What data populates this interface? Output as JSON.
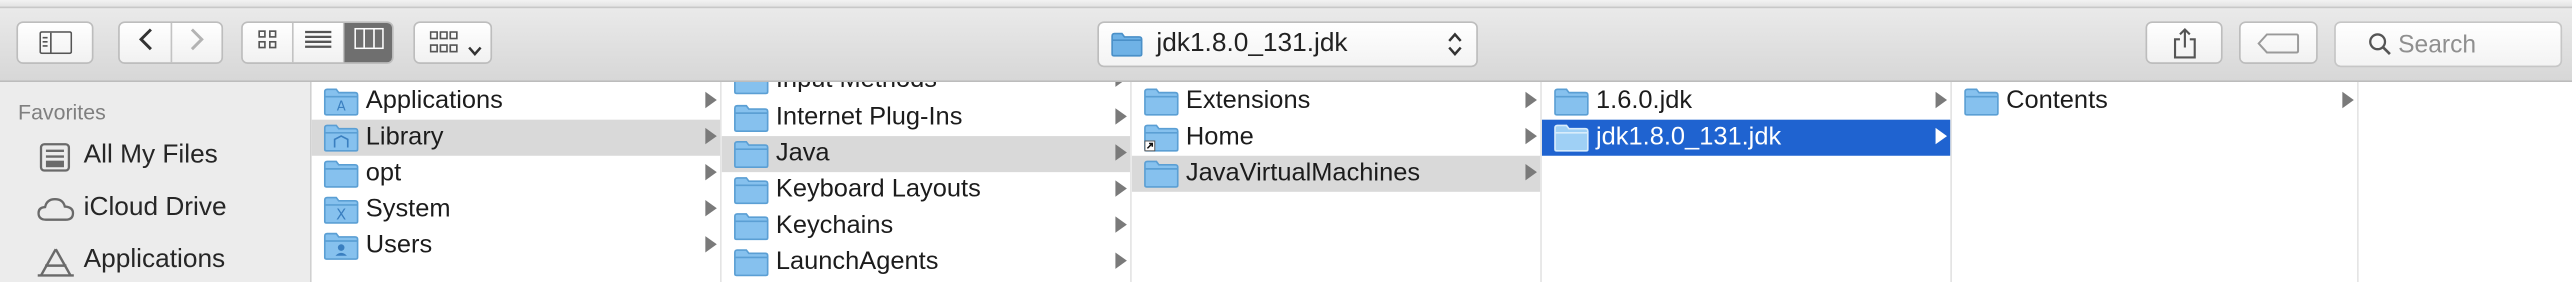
{
  "window": {
    "title": "jdk1.8.0_131.jdk"
  },
  "toolbar": {
    "search_placeholder": "Search",
    "view_modes": [
      "icon",
      "list",
      "column"
    ],
    "active_view": "column"
  },
  "sidebar": {
    "heading": "Favorites",
    "items": [
      {
        "label": "All My Files",
        "icon": "all-files-icon"
      },
      {
        "label": "iCloud Drive",
        "icon": "cloud-icon"
      },
      {
        "label": "Applications",
        "icon": "applications-icon"
      }
    ]
  },
  "columns": [
    {
      "items": [
        {
          "label": "Applications",
          "badge": "app"
        },
        {
          "label": "Library",
          "badge": "lib",
          "selected": "gray"
        },
        {
          "label": "opt",
          "badge": ""
        },
        {
          "label": "System",
          "badge": "x"
        },
        {
          "label": "Users",
          "badge": "user"
        }
      ]
    },
    {
      "items": [
        {
          "label": "Input Methods"
        },
        {
          "label": "Internet Plug-Ins"
        },
        {
          "label": "Java",
          "selected": "gray"
        },
        {
          "label": "Keyboard Layouts"
        },
        {
          "label": "Keychains"
        },
        {
          "label": "LaunchAgents"
        }
      ]
    },
    {
      "items": [
        {
          "label": "Extensions"
        },
        {
          "label": "Home",
          "alias": true
        },
        {
          "label": "JavaVirtualMachines",
          "selected": "gray"
        }
      ]
    },
    {
      "items": [
        {
          "label": "1.6.0.jdk"
        },
        {
          "label": "jdk1.8.0_131.jdk",
          "selected": "blue"
        }
      ]
    },
    {
      "items": [
        {
          "label": "Contents"
        }
      ]
    }
  ],
  "colors": {
    "selection_blue": "#1f63d0",
    "selection_gray": "#d9d9d9",
    "folder_blue": "#79b8e8"
  }
}
